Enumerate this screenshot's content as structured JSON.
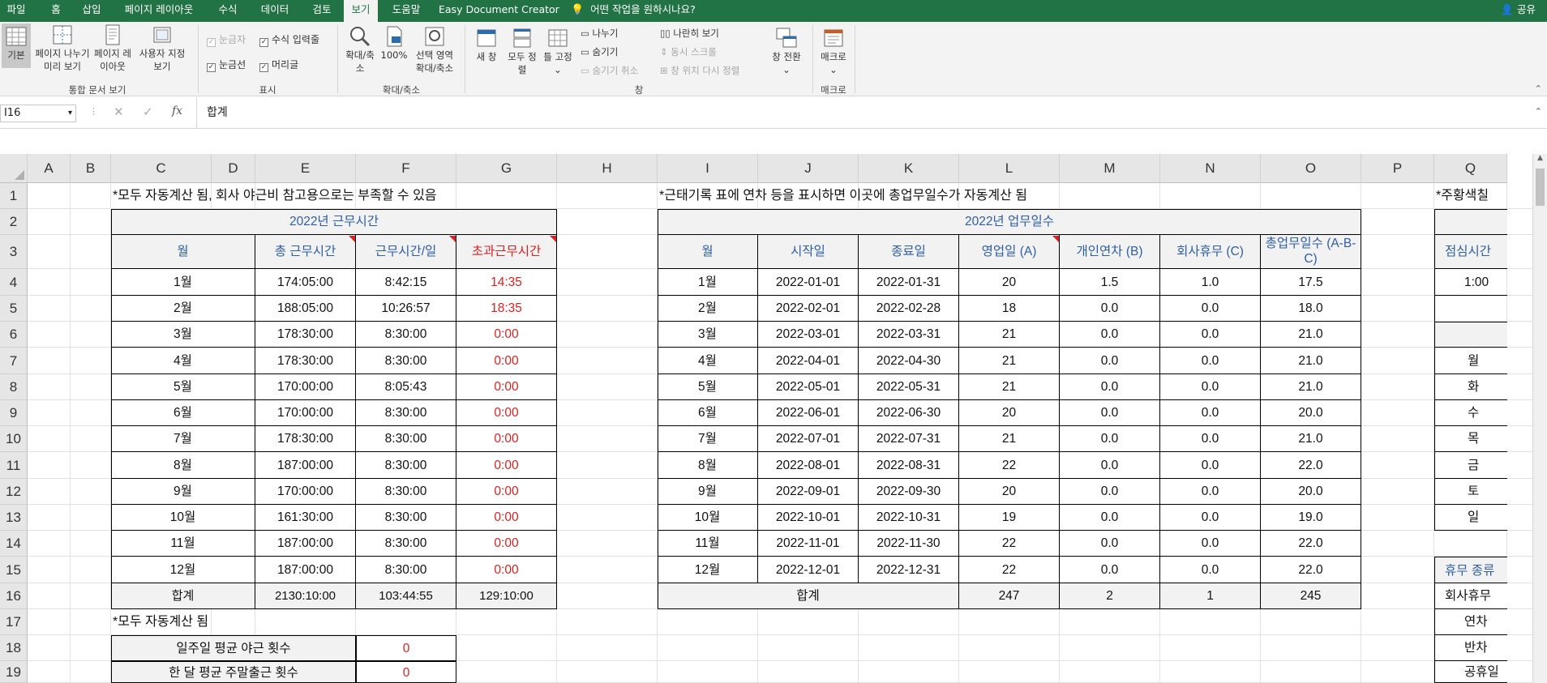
{
  "tabs": [
    "파일",
    "홈",
    "삽입",
    "페이지 레이아웃",
    "수식",
    "데이터",
    "검토",
    "보기",
    "도움말",
    "Easy Document Creator"
  ],
  "active_tab": "보기",
  "tell_me": "어떤 작업을 원하시나요?",
  "share": "공유",
  "ribbon": {
    "view_normal": "기본",
    "view_pagebreak": "페이지 나누기 미리 보기",
    "view_pagelayout": "페이지 레이아웃",
    "view_custom": "사용자 지정 보기",
    "group_workbook": "통합 문서 보기",
    "ruler": "눈금자",
    "formula_bar": "수식 입력줄",
    "gridlines": "눈금선",
    "headings": "머리글",
    "group_show": "표시",
    "zoom": "확대/축소",
    "zoom100": "100%",
    "zoom_sel": "선택 영역 확대/축소",
    "group_zoom": "확대/축소",
    "new_window": "새 창",
    "arrange_all": "모두 정렬",
    "freeze": "틀 고정",
    "split": "나누기",
    "hide": "숨기기",
    "unhide": "숨기기 취소",
    "side_by_side": "나란히 보기",
    "sync_scroll": "동시 스크롤",
    "reset_pos": "창 위치 다시 정렬",
    "switch_win": "창 전환",
    "group_window": "창",
    "macros": "매크로",
    "group_macro": "매크로"
  },
  "formula": {
    "cell_ref": "I16",
    "value": "합계",
    "fx": "fx"
  },
  "columns": [
    "A",
    "B",
    "C",
    "D",
    "E",
    "F",
    "G",
    "H",
    "I",
    "J",
    "K",
    "L",
    "M",
    "N",
    "O",
    "P",
    "Q"
  ],
  "rows": [
    "1",
    "2",
    "3",
    "4",
    "5",
    "6",
    "7",
    "8",
    "9",
    "10",
    "11",
    "12",
    "13",
    "14",
    "15",
    "16",
    "17",
    "18",
    "19"
  ],
  "note1": "*모두 자동계산 됨, 회사 야근비 참고용으로는 부족할 수 있음",
  "note2": "*근태기록 표에 연차 등을 표시하면 이곳에 총업무일수가 자동계산 됨",
  "note3": "*주황색칠",
  "note4": "*모두 자동계산 됨",
  "t1": {
    "title": "2022년 근무시간",
    "headers": [
      "월",
      "총 근무시간",
      "근무시간/일",
      "초과근무시간"
    ],
    "rows": [
      [
        "1월",
        "174:05:00",
        "8:42:15",
        "14:35"
      ],
      [
        "2월",
        "188:05:00",
        "10:26:57",
        "18:35"
      ],
      [
        "3월",
        "178:30:00",
        "8:30:00",
        "0:00"
      ],
      [
        "4월",
        "178:30:00",
        "8:30:00",
        "0:00"
      ],
      [
        "5월",
        "170:00:00",
        "8:05:43",
        "0:00"
      ],
      [
        "6월",
        "170:00:00",
        "8:30:00",
        "0:00"
      ],
      [
        "7월",
        "178:30:00",
        "8:30:00",
        "0:00"
      ],
      [
        "8월",
        "187:00:00",
        "8:30:00",
        "0:00"
      ],
      [
        "9월",
        "170:00:00",
        "8:30:00",
        "0:00"
      ],
      [
        "10월",
        "161:30:00",
        "8:30:00",
        "0:00"
      ],
      [
        "11월",
        "187:00:00",
        "8:30:00",
        "0:00"
      ],
      [
        "12월",
        "187:00:00",
        "8:30:00",
        "0:00"
      ]
    ],
    "total": [
      "합계",
      "2130:10:00",
      "103:44:55",
      "129:10:00"
    ]
  },
  "t2": {
    "title": "2022년 업무일수",
    "headers": [
      "월",
      "시작일",
      "종료일",
      "영업일 (A)",
      "개인연차 (B)",
      "회사휴무 (C)",
      "총업무일수 (A-B-C)"
    ],
    "rows": [
      [
        "1월",
        "2022-01-01",
        "2022-01-31",
        "20",
        "1.5",
        "1.0",
        "17.5"
      ],
      [
        "2월",
        "2022-02-01",
        "2022-02-28",
        "18",
        "0.0",
        "0.0",
        "18.0"
      ],
      [
        "3월",
        "2022-03-01",
        "2022-03-31",
        "21",
        "0.0",
        "0.0",
        "21.0"
      ],
      [
        "4월",
        "2022-04-01",
        "2022-04-30",
        "21",
        "0.0",
        "0.0",
        "21.0"
      ],
      [
        "5월",
        "2022-05-01",
        "2022-05-31",
        "21",
        "0.0",
        "0.0",
        "21.0"
      ],
      [
        "6월",
        "2022-06-01",
        "2022-06-30",
        "20",
        "0.0",
        "0.0",
        "20.0"
      ],
      [
        "7월",
        "2022-07-01",
        "2022-07-31",
        "21",
        "0.0",
        "0.0",
        "21.0"
      ],
      [
        "8월",
        "2022-08-01",
        "2022-08-31",
        "22",
        "0.0",
        "0.0",
        "22.0"
      ],
      [
        "9월",
        "2022-09-01",
        "2022-09-30",
        "20",
        "0.0",
        "0.0",
        "20.0"
      ],
      [
        "10월",
        "2022-10-01",
        "2022-10-31",
        "19",
        "0.0",
        "0.0",
        "19.0"
      ],
      [
        "11월",
        "2022-11-01",
        "2022-11-30",
        "22",
        "0.0",
        "0.0",
        "22.0"
      ],
      [
        "12월",
        "2022-12-01",
        "2022-12-31",
        "22",
        "0.0",
        "0.0",
        "22.0"
      ]
    ],
    "total": [
      "합계",
      "247",
      "2",
      "1",
      "245"
    ]
  },
  "q_col": {
    "header": "점심시간",
    "r4": "1:00",
    "days": [
      "월",
      "화",
      "수",
      "목",
      "금",
      "토",
      "일"
    ],
    "r15": "휴무 종류",
    "r16": "회사휴무",
    "r17": "연차",
    "r18": "반차",
    "r19": "공휴일"
  },
  "t3": {
    "rows": [
      [
        "일주일 평균 야근 횟수",
        "0"
      ],
      [
        "한 달 평균 주말출근 횟수",
        "0"
      ]
    ]
  },
  "colors": {
    "accent": "#217346",
    "header_text": "#2e5ea8",
    "overtime_red": "#e02020"
  }
}
